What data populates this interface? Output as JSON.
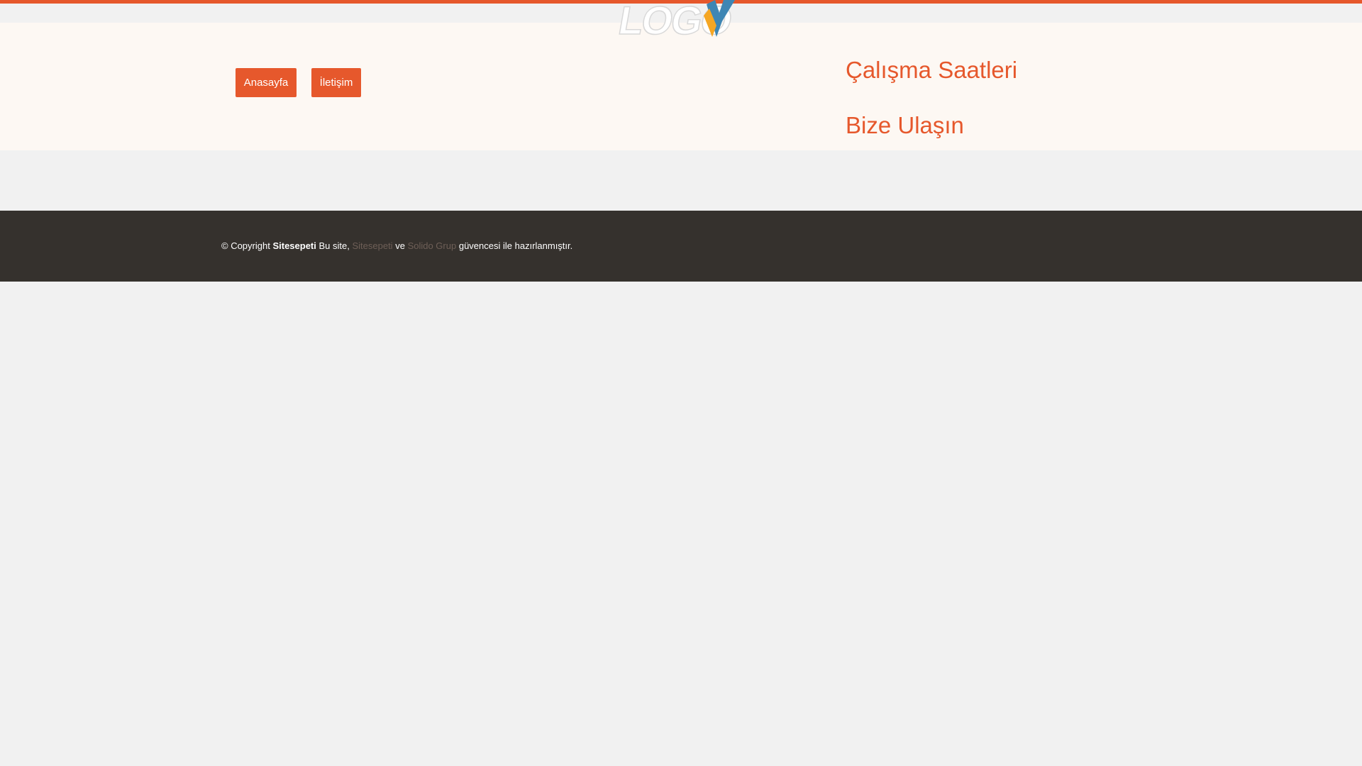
{
  "nav": {
    "home_label": "Anasayfa",
    "contact_label": "İletişim"
  },
  "logo": {
    "text": "LOGO"
  },
  "sections": {
    "hours_title": "Çalışma Saatleri",
    "contact_title": "Bize Ulaşın"
  },
  "footer": {
    "copyright_prefix": "© Copyright",
    "brand": "Sitesepeti",
    "made_by_text": "Bu site,",
    "link1": "Sitesepeti",
    "conjunction": "ve",
    "link2": "Solido Grup",
    "suffix": "güvencesi ile hazırlanmıştır."
  },
  "colors": {
    "accent": "#e6582c",
    "header_bg": "#fdf8f3",
    "page_bg": "#f1f1f1",
    "footer_bg": "#35312d",
    "logo_blue": "#3e86b4",
    "logo_orange": "#f5a623"
  }
}
